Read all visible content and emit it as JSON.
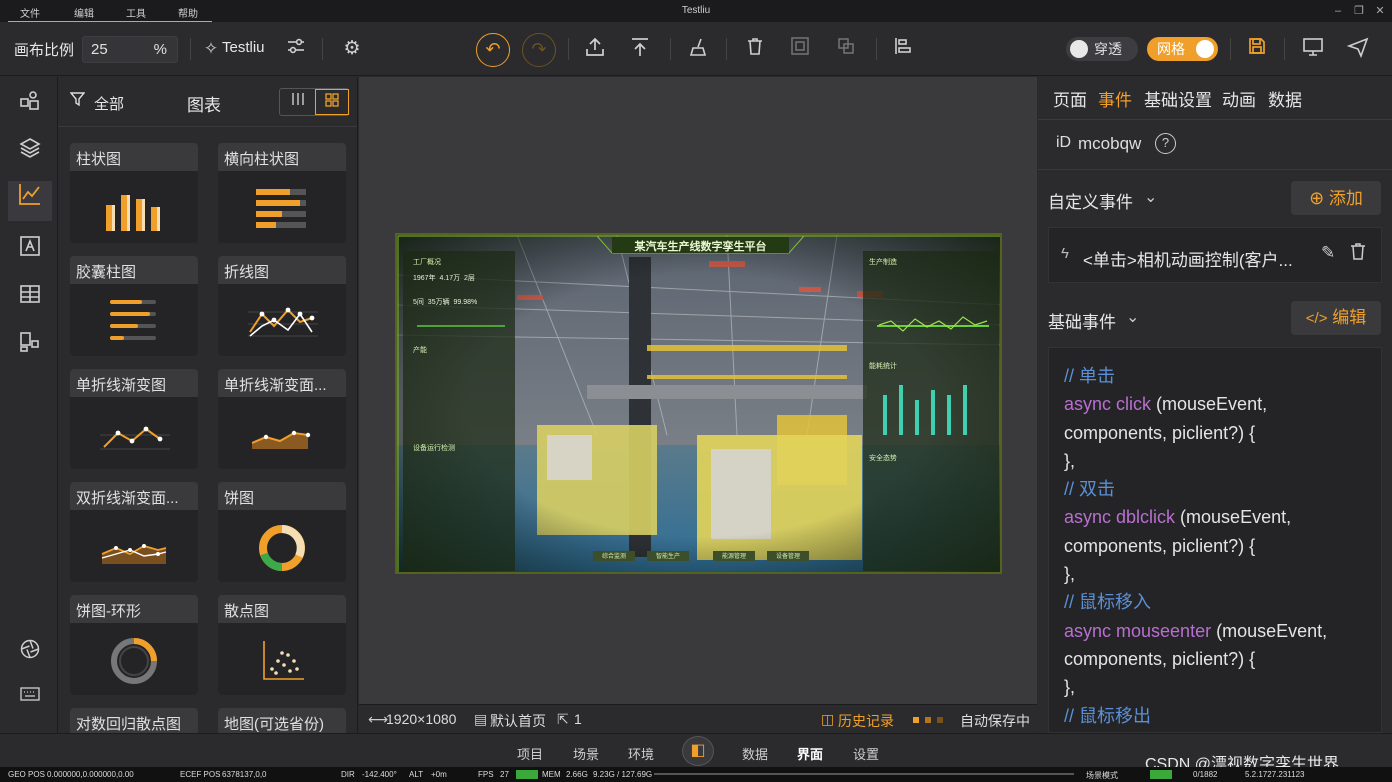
{
  "menu": {
    "file": "文件",
    "edit": "编辑",
    "tools": "工具",
    "help": "帮助"
  },
  "app_title": "Testliu",
  "toolbar": {
    "ratio_label": "画布比例",
    "ratio_value": "25",
    "ratio_unit": "%",
    "project_name": "Testliu",
    "transparent_label": "穿透",
    "grid_label": "网格"
  },
  "panel": {
    "filter_label": "全部",
    "title": "图表",
    "cards": [
      {
        "label": "柱状图"
      },
      {
        "label": "横向柱状图"
      },
      {
        "label": "胶囊柱图"
      },
      {
        "label": "折线图"
      },
      {
        "label": "单折线渐变图"
      },
      {
        "label": "单折线渐变面..."
      },
      {
        "label": "双折线渐变面..."
      },
      {
        "label": "饼图"
      },
      {
        "label": "饼图-环形"
      },
      {
        "label": "散点图"
      },
      {
        "label": "对数回归散点图"
      },
      {
        "label": "地图(可选省份)"
      }
    ]
  },
  "scene": {
    "title": "某汽车生产线数字孪生平台",
    "sections": {
      "factory": "工厂概况",
      "output": "产能",
      "equipment": "设备运行检测",
      "manufacture": "生产制造",
      "energy": "能耗统计",
      "safety": "安全态势"
    },
    "stats": [
      "1967年",
      "4.17万",
      "2层",
      "5间",
      "35万辆",
      "99.98%"
    ],
    "bottom_buttons": [
      "综合监测",
      "智能生产",
      "能源管理",
      "设备管理"
    ]
  },
  "canvas_status": {
    "resolution": "1920×1080",
    "home": "默认首页",
    "count": "1",
    "history": "历史记录",
    "autosave": "自动保存中"
  },
  "rpanel": {
    "tabs": [
      "页面",
      "事件",
      "基础设置",
      "动画",
      "数据"
    ],
    "active_tab": "事件",
    "id_label": "iD",
    "id_value": "mcobqw",
    "custom_events": "自定义事件",
    "add_label": "添加",
    "event_item": "<单击>相机动画控制(客户...",
    "base_events": "基础事件",
    "edit_label": "编辑",
    "code": [
      {
        "type": "comment",
        "text": "// 单击"
      },
      {
        "type": "kw",
        "text": "async click",
        "rest": " (mouseEvent,"
      },
      {
        "type": "plain",
        "text": "components, piclient?) {"
      },
      {
        "type": "plain",
        "text": "},"
      },
      {
        "type": "comment",
        "text": "// 双击"
      },
      {
        "type": "kw",
        "text": "async dblclick",
        "rest": " (mouseEvent,"
      },
      {
        "type": "plain",
        "text": "components, piclient?) {"
      },
      {
        "type": "plain",
        "text": "},"
      },
      {
        "type": "comment",
        "text": "// 鼠标移入"
      },
      {
        "type": "kw",
        "text": "async mouseenter",
        "rest": " (mouseEvent,"
      },
      {
        "type": "plain",
        "text": "components, piclient?) {"
      },
      {
        "type": "plain",
        "text": "},"
      },
      {
        "type": "comment",
        "text": "// 鼠标移出"
      }
    ]
  },
  "bottomnav": [
    "项目",
    "场景",
    "环境",
    "数据",
    "界面",
    "设置"
  ],
  "active_nav": "界面",
  "watermark": "CSDN @漂视数字孪生世界",
  "geo": {
    "geo_pos_label": "GEO POS",
    "geo_pos": "0.000000,0.000000,0.00",
    "ecef_label": "ECEF POS",
    "ecef": "6378137,0,0",
    "dir_label": "DIR",
    "dir": "-142.400°",
    "alt_label": "ALT",
    "alt": "+0m",
    "fps_label": "FPS",
    "fps": "27",
    "mem_label": "MEM",
    "mem": "2.66G",
    "mem2": "9.23G / 127.69G",
    "mode": "场景模式",
    "ratio": "0/1882",
    "version": "5.2.1727.231123"
  },
  "colors": {
    "accent": "#f0a02a",
    "panel": "#2b2b2e",
    "canvas": "#3a3a3c"
  }
}
